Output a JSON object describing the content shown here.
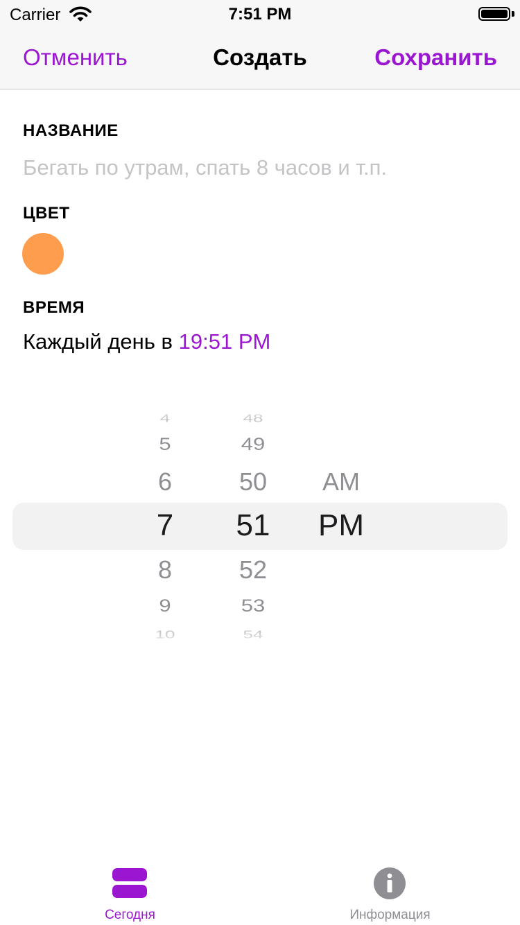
{
  "status_bar": {
    "carrier": "Carrier",
    "time": "7:51 PM"
  },
  "nav": {
    "cancel_label": "Отменить",
    "title": "Создать",
    "save_label": "Сохранить"
  },
  "form": {
    "name": {
      "label": "НАЗВАНИЕ",
      "value": "",
      "placeholder": "Бегать по утрам, спать 8 часов и т.п."
    },
    "color": {
      "label": "ЦВЕТ",
      "selected_color": "#FF9D4F"
    },
    "time": {
      "label": "ВРЕМЯ",
      "prefix": "Каждый день в",
      "value": "19:51 PM"
    }
  },
  "picker": {
    "hours": [
      "4",
      "5",
      "6",
      "7",
      "8",
      "9",
      "10"
    ],
    "minutes": [
      "48",
      "49",
      "50",
      "51",
      "52",
      "53",
      "54"
    ],
    "periods": [
      "AM",
      "PM"
    ],
    "selected": {
      "hour": "7",
      "minute": "51",
      "period": "PM"
    }
  },
  "tab_bar": {
    "tabs": [
      {
        "label": "Сегодня",
        "icon": "stack-icon",
        "active": true
      },
      {
        "label": "Информация",
        "icon": "info-icon",
        "active": false
      }
    ]
  },
  "colors": {
    "accent": "#9B16D0",
    "inactive": "#8E8E93",
    "placeholder": "#C4C4C7",
    "swatch": "#FF9D4F"
  }
}
